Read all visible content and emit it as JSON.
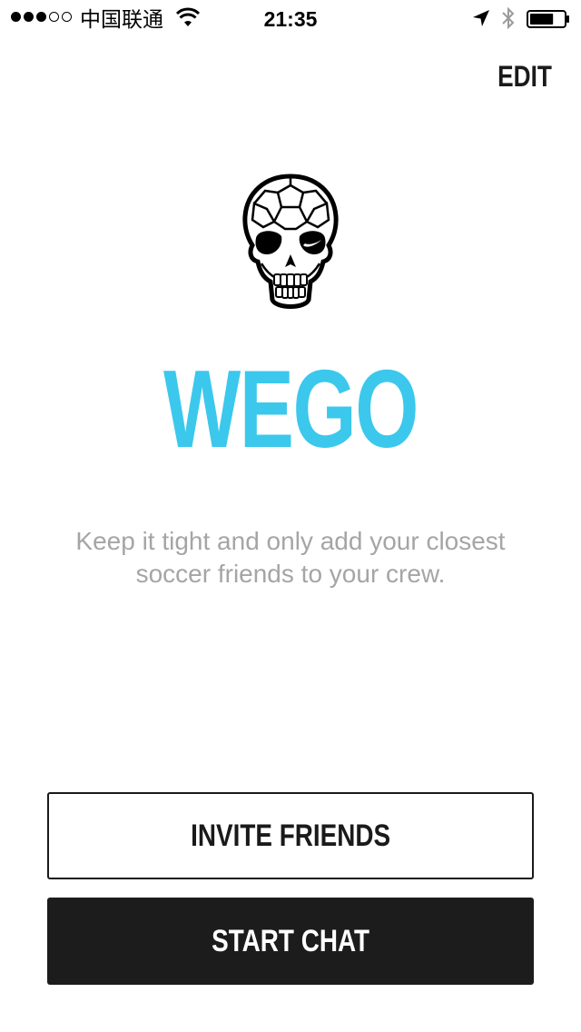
{
  "status_bar": {
    "signal_dots_filled": 3,
    "signal_dots_total": 5,
    "carrier": "中国联通",
    "time": "21:35",
    "icons": [
      "wifi-icon",
      "location-icon",
      "bluetooth-icon",
      "battery-icon"
    ],
    "battery_level": 0.7
  },
  "nav": {
    "edit_label": "EDIT"
  },
  "logo": {
    "icon": "soccer-skull-logo"
  },
  "main": {
    "title": "WEGO",
    "tagline": "Keep it tight and only add your closest soccer friends to your crew."
  },
  "actions": {
    "invite_label": "INVITE FRIENDS",
    "start_chat_label": "START CHAT"
  },
  "colors": {
    "accent": "#3bc8ec",
    "text_dark": "#1a1a1a",
    "tagline_gray": "#a5a5a5",
    "button_dark": "#1c1c1c",
    "background": "#ffffff"
  }
}
